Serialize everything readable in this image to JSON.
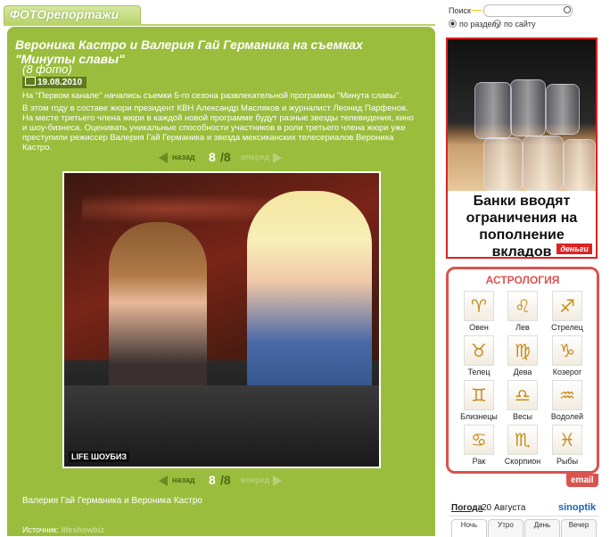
{
  "header": {
    "section_title": "ФОТОрепортажи"
  },
  "article": {
    "title": "Вероника Кастро и Валерия Гай Германика на съемках \"Минуты славы\"",
    "photo_count": "(8 фото)",
    "date": "19.08.2010",
    "intro": "На \"Первом канале\" начались съемки 5-го сезона развлекательной программы \"Минута славы\".",
    "description": "В этом году в составе жюри президент КВН Александр Масляков и журналист Леонид Парфенов. На месте третьего члена жюри в каждой новой программе будут разные звезды телевидения, кино и шоу-бизнеса. Оценивать уникальные способности участников в роли третьего члена жюри уже преступили режиссер Валерия Гай Германика и звезда мексиканских телесериалов Вероника Кастро.",
    "photo_watermark": "LIFE ШОУБИЗ",
    "caption": "Валерия Гай Германика и Вероника Кастро",
    "source_label": "Источник:",
    "source_value": "lifeshowbiz"
  },
  "pager": {
    "prev": "назад",
    "current": "8",
    "total": "/8",
    "next": "вперед"
  },
  "search": {
    "label": "Поиск",
    "placeholder": "",
    "option_section": "по разделу",
    "option_site": "по сайту"
  },
  "ad": {
    "text": "Банки вводят ограничения на пополнение вкладов",
    "logo": "деньги"
  },
  "astro": {
    "title": "АСТРОЛОГИЯ",
    "signs": [
      {
        "name": "Овен",
        "glyph": "♈"
      },
      {
        "name": "Лев",
        "glyph": "♌"
      },
      {
        "name": "Стрелец",
        "glyph": "♐"
      },
      {
        "name": "Телец",
        "glyph": "♉"
      },
      {
        "name": "Дева",
        "glyph": "♍"
      },
      {
        "name": "Козерог",
        "glyph": "♑"
      },
      {
        "name": "Близнецы",
        "glyph": "♊"
      },
      {
        "name": "Весы",
        "glyph": "♎"
      },
      {
        "name": "Водолей",
        "glyph": "♒"
      },
      {
        "name": "Рак",
        "glyph": "♋"
      },
      {
        "name": "Скорпион",
        "glyph": "♏"
      },
      {
        "name": "Рыбы",
        "glyph": "♓"
      }
    ],
    "email": "email"
  },
  "weather": {
    "title": "Погода",
    "date": "20 Августа",
    "source": "sinoptik",
    "tabs": [
      "Ночь",
      "Утро",
      "День",
      "Вечер"
    ]
  }
}
